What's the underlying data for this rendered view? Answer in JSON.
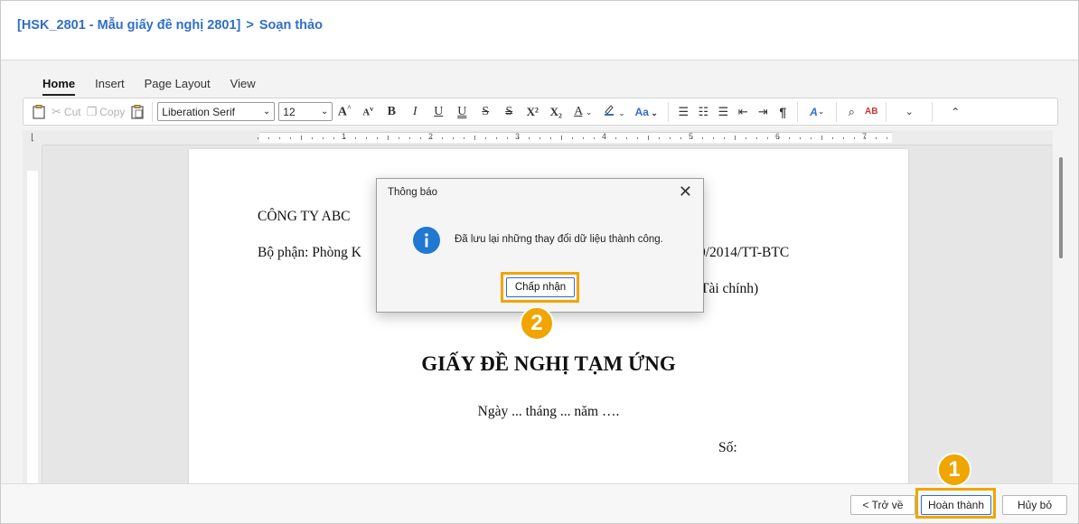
{
  "header": {
    "breadcrumb_doc": "[HSK_2801 - Mẫu giấy đề nghị 2801]",
    "breadcrumb_sep": ">",
    "breadcrumb_current": "Soạn thảo"
  },
  "tabs": [
    {
      "label": "Home",
      "active": true
    },
    {
      "label": "Insert"
    },
    {
      "label": "Page Layout"
    },
    {
      "label": "View"
    }
  ],
  "ribbon": {
    "cut_label": "Cut",
    "copy_label": "Copy",
    "font_family": "Liberation Serif",
    "font_size": "12",
    "bold": "B",
    "italic": "I",
    "underline": "U",
    "double_underline": "U",
    "strike": "S",
    "double_strike": "S",
    "superscript": "X²",
    "subscript": "X₂",
    "font_color": "A",
    "case": "Aa",
    "grow_font": "A",
    "shrink_font": "A",
    "pilcrow": "¶"
  },
  "ruler": {
    "marks": [
      "1",
      "2",
      "3",
      "4",
      "5",
      "6",
      "7"
    ]
  },
  "document": {
    "company": "CÔNG TY ABC",
    "department": "Bộ phận: Phòng K",
    "circular_fragment": "0/2014/TT-BTC",
    "ministry_fragment": "Tài chính)",
    "title": "GIẤY ĐỀ NGHỊ TẠM ỨNG",
    "date_line": "Ngày ... tháng ... năm ….",
    "number_label": "Số:"
  },
  "dialog": {
    "title": "Thông báo",
    "message": "Đã lưu lại những thay đổi dữ liệu thành công.",
    "ok_label": "Chấp nhận",
    "close_glyph": "✕"
  },
  "footer": {
    "back_label": "< Trở về",
    "finish_label": "Hoàn thành",
    "cancel_label": "Hủy bỏ"
  },
  "markers": {
    "step1": "1",
    "step2": "2"
  },
  "colors": {
    "accent": "#2f6fc8",
    "highlight": "#f0a500",
    "info_icon": "#1f78d1"
  }
}
